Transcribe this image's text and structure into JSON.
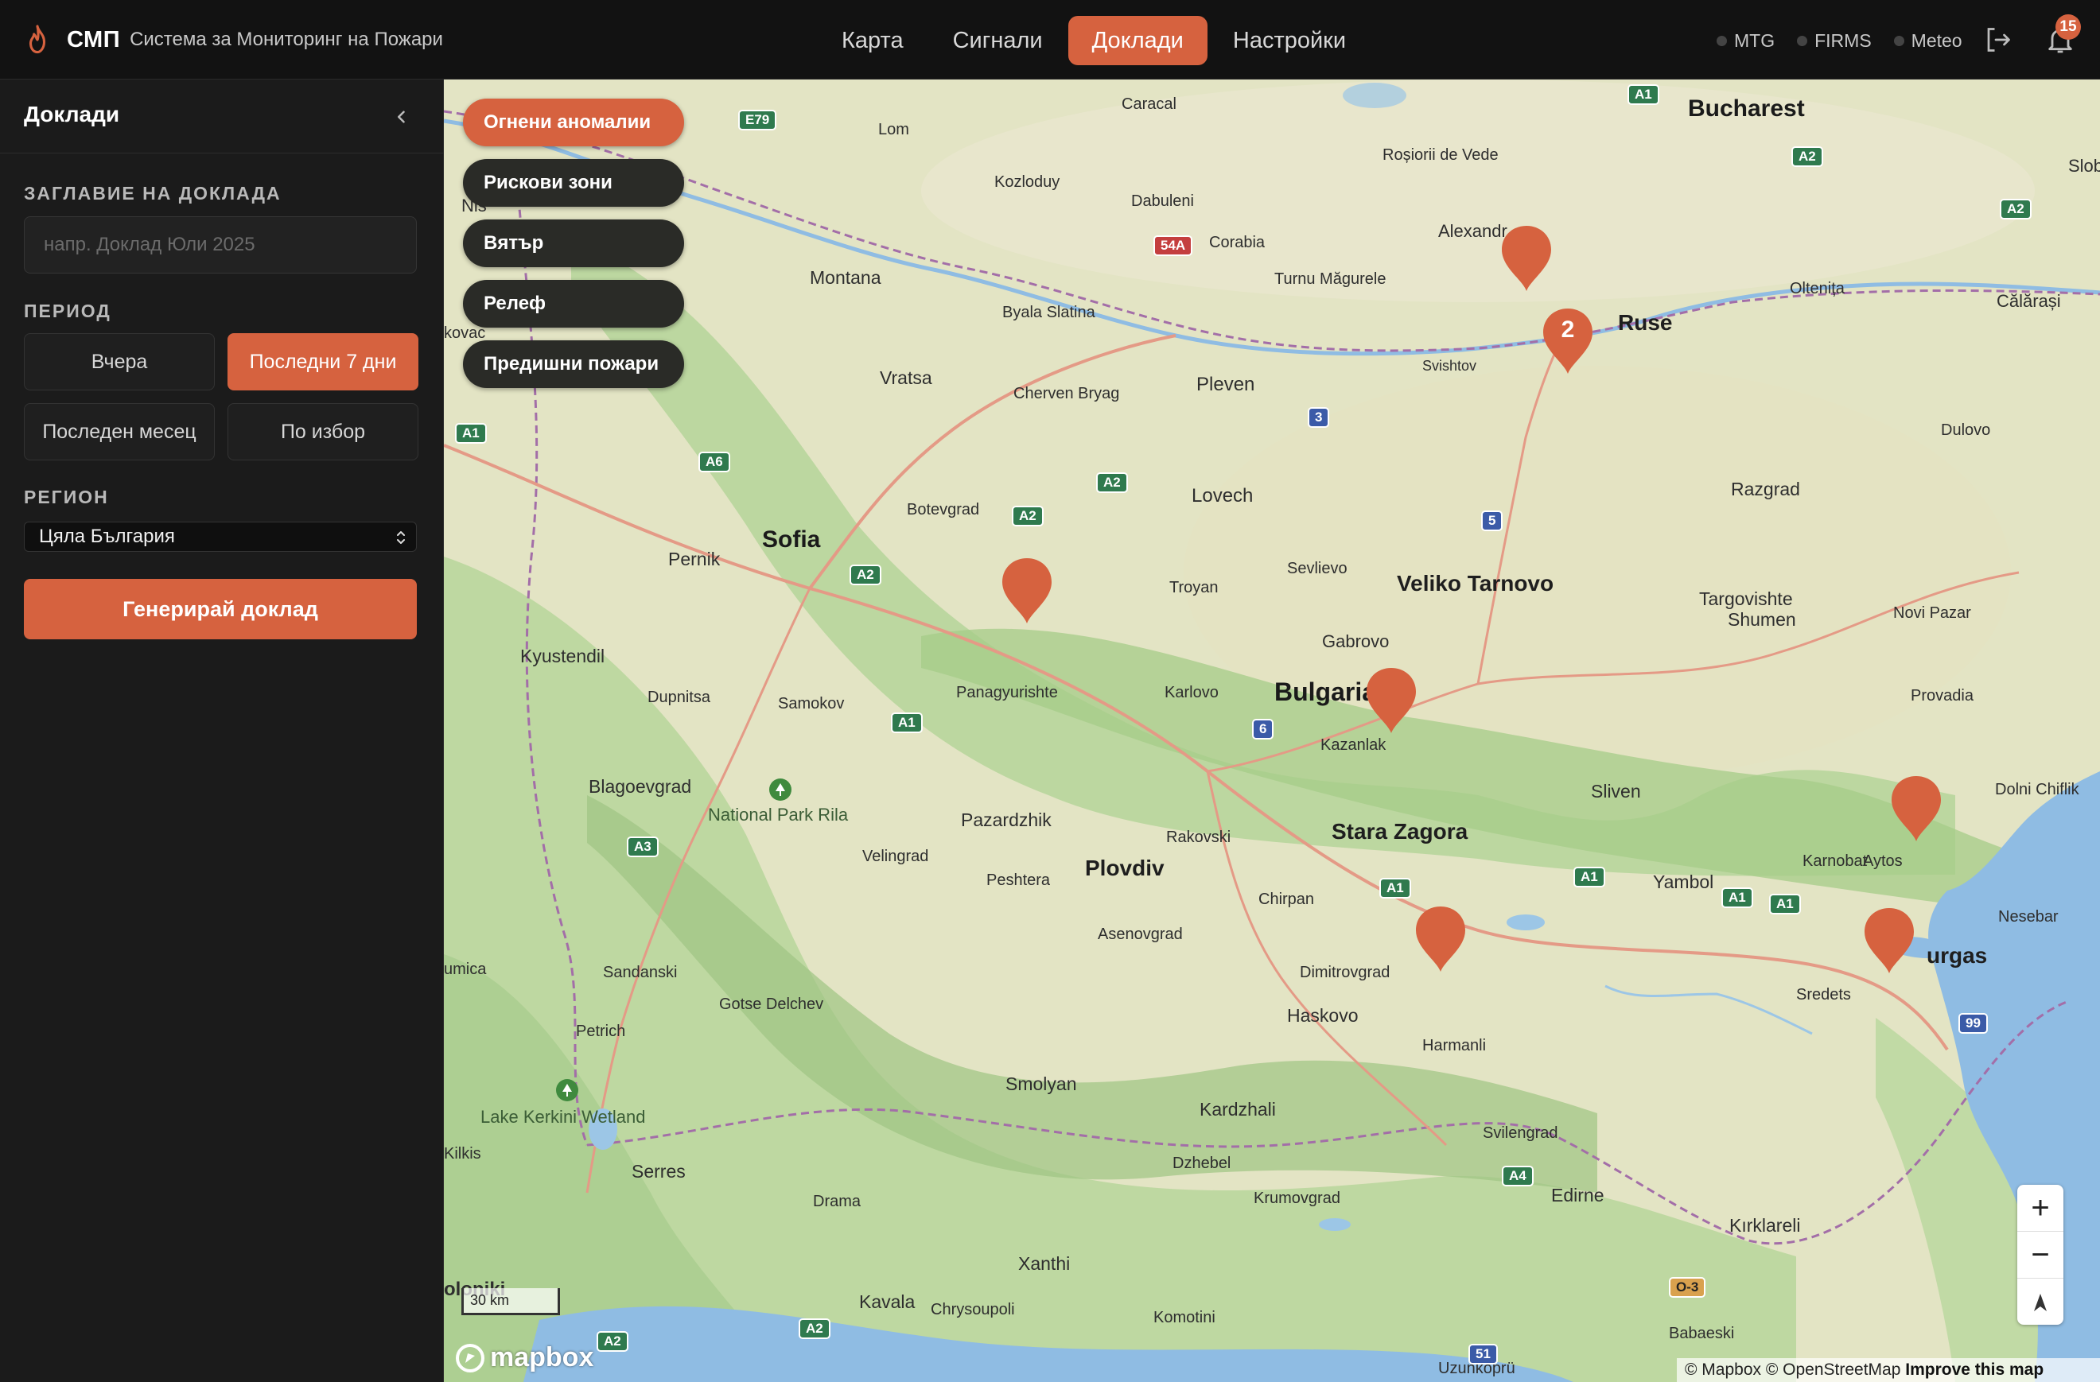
{
  "app": {
    "brand": "СМП",
    "subtitle": "Система за Мониторинг на Пожари"
  },
  "nav": {
    "tabs": [
      {
        "label": "Карта"
      },
      {
        "label": "Сигнали"
      },
      {
        "label": "Доклади"
      },
      {
        "label": "Настройки"
      }
    ],
    "active": "Доклади"
  },
  "status": {
    "sources": [
      "MTG",
      "FIRMS",
      "Meteo"
    ]
  },
  "notifications": {
    "count": "15"
  },
  "sidebar": {
    "title": "Доклади",
    "report_title_label": "ЗАГЛАВИЕ НА ДОКЛАДА",
    "report_title_placeholder": "напр. Доклад Юли 2025",
    "report_title_value": "",
    "period_label": "ПЕРИОД",
    "period_options": [
      "Вчера",
      "Последни 7 дни",
      "Последен месец",
      "По избор"
    ],
    "period_selected": "Последни 7 дни",
    "region_label": "РЕГИОН",
    "region_value": "Цяла България",
    "generate_label": "Генерирай доклад"
  },
  "map": {
    "layers": [
      {
        "label": "Огнени аномалии",
        "active": true
      },
      {
        "label": "Рискови зони",
        "active": false
      },
      {
        "label": "Вятър",
        "active": false
      },
      {
        "label": "Релеф",
        "active": false
      },
      {
        "label": "Предишни пожари",
        "active": false
      }
    ],
    "cluster_count": "2",
    "marker_count": 8,
    "scale": "30 km",
    "logo": "mapbox",
    "attribution": "© Mapbox © OpenStreetMap",
    "attribution_link": "Improve this map",
    "places": {
      "bucharest": "Bucharest",
      "sofia": "Sofia",
      "plovdiv": "Plovdiv",
      "bulgaria": "Bulgaria",
      "veliko": "Veliko Tarnovo",
      "stara": "Stara Zagora",
      "ruse": "Ruse",
      "burgas": "urgas",
      "pleven": "Pleven",
      "lovech": "Lovech",
      "vratsa": "Vratsa",
      "montana": "Montana",
      "pernik": "Pernik",
      "kyustendil": "Kyustendil",
      "blagoevgrad": "Blagoevgrad",
      "pazardzhik": "Pazardzhik",
      "haskovo": "Haskovo",
      "smolyan": "Smolyan",
      "kardzhali": "Kardzhali",
      "yambol": "Yambol",
      "sliven": "Sliven",
      "shumen": "Shumen",
      "targovishte": "Targovishte",
      "razgrad": "Razgrad",
      "gabrovo": "Gabrovo",
      "kazanlak": "Kazanlak",
      "sevlievo": "Sevlievo",
      "troyan": "Troyan",
      "karlovo": "Karlovo",
      "dimitrovgrad": "Dimitrovgrad",
      "chirpan": "Chirpan",
      "harmanli": "Harmanli",
      "svilengrad": "Svilengrad",
      "edirne": "Edirne",
      "kirklareli": "Kırklareli",
      "xanthi": "Xanthi",
      "kavala": "Kavala",
      "drama": "Drama",
      "serres": "Serres",
      "samokov": "Samokov",
      "dupnitsa": "Dupnitsa",
      "panagyurishte": "Panagyurishte",
      "botevgrad": "Botevgrad",
      "velingrad": "Velingrad",
      "peshtera": "Peshtera",
      "rakovski": "Rakovski",
      "asenovgrad": "Asenovgrad",
      "sandanski": "Sandanski",
      "gotse": "Gotse Delchev",
      "petrich": "Petrich",
      "rila": "National Park Rila",
      "kerkini": "Lake Kerkini Wetland",
      "alexandria": "Alexandr",
      "caracal": "Caracal",
      "rosiorii": "Roșiorii de Vede",
      "turnu": "Turnu Măgurele",
      "dabuleni": "Dabuleni",
      "corabia": "Corabia",
      "kozloduy": "Kozloduy",
      "lom": "Lom",
      "oltenita": "Oltenița",
      "calarasi": "Călărași",
      "dulovo": "Dulovo",
      "novipazar": "Novi Pazar",
      "provadia": "Provadia",
      "aytos": "Aytos",
      "karnobat": "Karnobat",
      "nesebar": "Nesebar",
      "sredets": "Sredets",
      "dolni": "Dolni Chiflik",
      "byala": "Byala Slatina",
      "cherven": "Cherven Bryag",
      "svishtov": "Svishtov",
      "kilkis": "Kilkis",
      "chrysoupoli": "Chrysoupoli",
      "komotini": "Komotini",
      "krumovgrad": "Krumovgrad",
      "dzhebel": "Dzhebel",
      "uzunkopru": "Uzunköprü",
      "babaeski": "Babaeski",
      "nis": "Niš",
      "slob": "Slob",
      "kovac": "kovac",
      "umica": "umica",
      "oloniki": "oloniki"
    }
  }
}
